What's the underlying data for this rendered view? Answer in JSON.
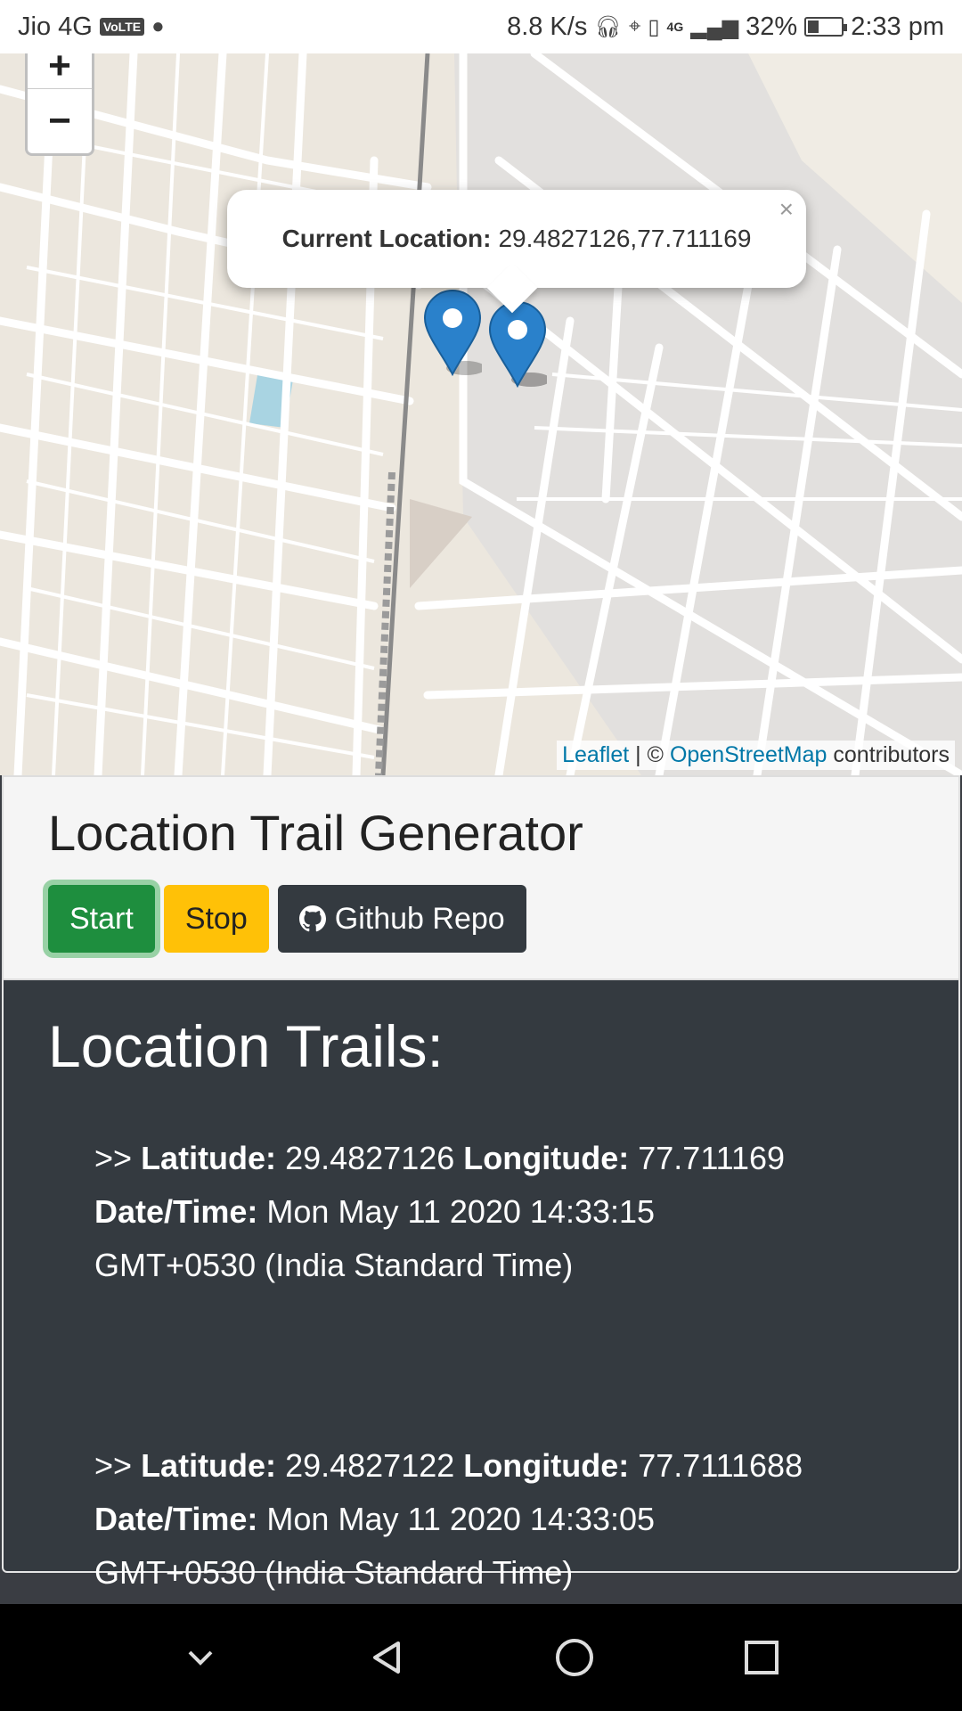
{
  "status_bar": {
    "carrier": "Jio 4G",
    "volte": "VoLTE",
    "speed": "8.8 K/s",
    "network": "4G",
    "battery_percent": "32%",
    "battery_level": 0.32,
    "time": "2:33 pm"
  },
  "map": {
    "zoom_in_label": "+",
    "zoom_out_label": "−",
    "popup": {
      "label": "Current Location:",
      "value": "29.4827126,77.711169",
      "close": "×"
    },
    "attribution": {
      "leaflet": "Leaflet",
      "separator": " | © ",
      "osm": "OpenStreetMap",
      "suffix": " contributors"
    },
    "marker_color": "#2a81cb"
  },
  "panel": {
    "title": "Location Trail Generator",
    "start_label": "Start",
    "stop_label": "Stop",
    "github_label": "Github Repo"
  },
  "trails": {
    "heading": "Location Trails:",
    "entries": [
      {
        "prefix": ">> ",
        "lat_label": "Latitude:",
        "lat": "29.4827126",
        "lon_label": "Longitude:",
        "lon": "77.711169",
        "dt_label": "Date/Time:",
        "dt": "Mon May 11 2020 14:33:15",
        "tz": "GMT+0530 (India Standard Time)"
      },
      {
        "prefix": ">> ",
        "lat_label": "Latitude:",
        "lat": "29.4827122",
        "lon_label": "Longitude:",
        "lon": "77.7111688",
        "dt_label": "Date/Time:",
        "dt": "Mon May 11 2020 14:33:05",
        "tz": "GMT+0530 (India Standard Time)"
      }
    ]
  },
  "colors": {
    "start": "#1e8e3e",
    "stop": "#ffc107",
    "dark": "#343a40",
    "link": "#0078a8"
  }
}
